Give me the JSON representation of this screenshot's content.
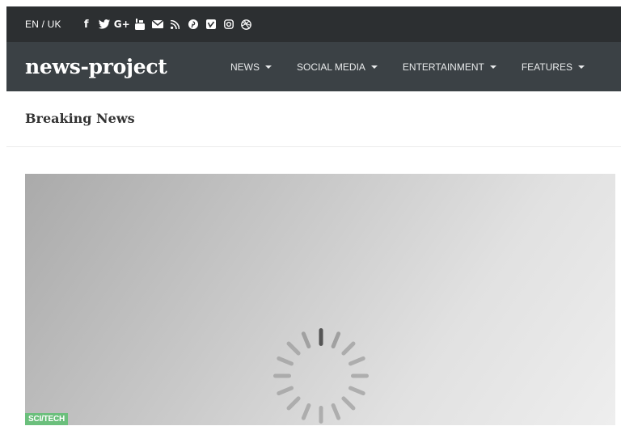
{
  "topbar": {
    "language": "EN / UK",
    "social_icons": [
      {
        "name": "facebook-icon",
        "glyph": "f"
      },
      {
        "name": "twitter-icon",
        "glyph": "❦"
      },
      {
        "name": "google-plus-icon",
        "glyph": "G+"
      },
      {
        "name": "youtube-icon",
        "glyph": "▣"
      },
      {
        "name": "email-icon",
        "glyph": "✉"
      },
      {
        "name": "rss-icon",
        "glyph": "≂"
      },
      {
        "name": "pinterest-icon",
        "glyph": "℗"
      },
      {
        "name": "vimeo-icon",
        "glyph": "ⓥ"
      },
      {
        "name": "instagram-icon",
        "glyph": "◎"
      },
      {
        "name": "dribbble-icon",
        "glyph": "⊛"
      }
    ]
  },
  "navbar": {
    "brand": "news-project",
    "menu": [
      {
        "label": "NEWS"
      },
      {
        "label": "SOCIAL MEDIA"
      },
      {
        "label": "ENTERTAINMENT"
      },
      {
        "label": "FEATURES"
      }
    ]
  },
  "main": {
    "section_title": "Breaking News",
    "featured": {
      "category": "SCI/TECH",
      "loading_icon": "spinner-icon"
    }
  },
  "colors": {
    "topbar_bg": "#2c2f31",
    "navbar_bg": "#3b4145",
    "badge_bg": "#6bbf7c"
  }
}
